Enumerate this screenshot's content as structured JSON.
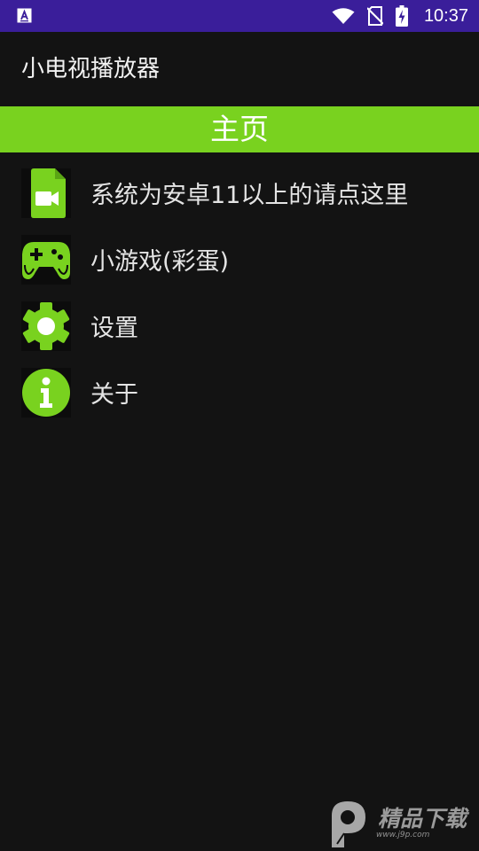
{
  "status_bar": {
    "time": "10:37",
    "left_icon": "app-notification-icon",
    "icons": [
      "wifi-icon",
      "no-sim-icon",
      "battery-charging-icon"
    ]
  },
  "app_bar": {
    "title": "小电视播放器"
  },
  "home_banner": {
    "label": "主页",
    "color": "#79d21f"
  },
  "menu": {
    "items": [
      {
        "label": "系统为安卓11以上的请点这里",
        "icon": "video-file-icon"
      },
      {
        "label": "小游戏(彩蛋)",
        "icon": "gamepad-icon"
      },
      {
        "label": "设置",
        "icon": "gear-icon"
      },
      {
        "label": "关于",
        "icon": "info-icon"
      }
    ]
  },
  "watermark": {
    "text": "精品下载",
    "sub": "www.j9p.com"
  },
  "colors": {
    "accent": "#79d21f",
    "status_bar": "#3a1e9a",
    "background": "#131313"
  }
}
